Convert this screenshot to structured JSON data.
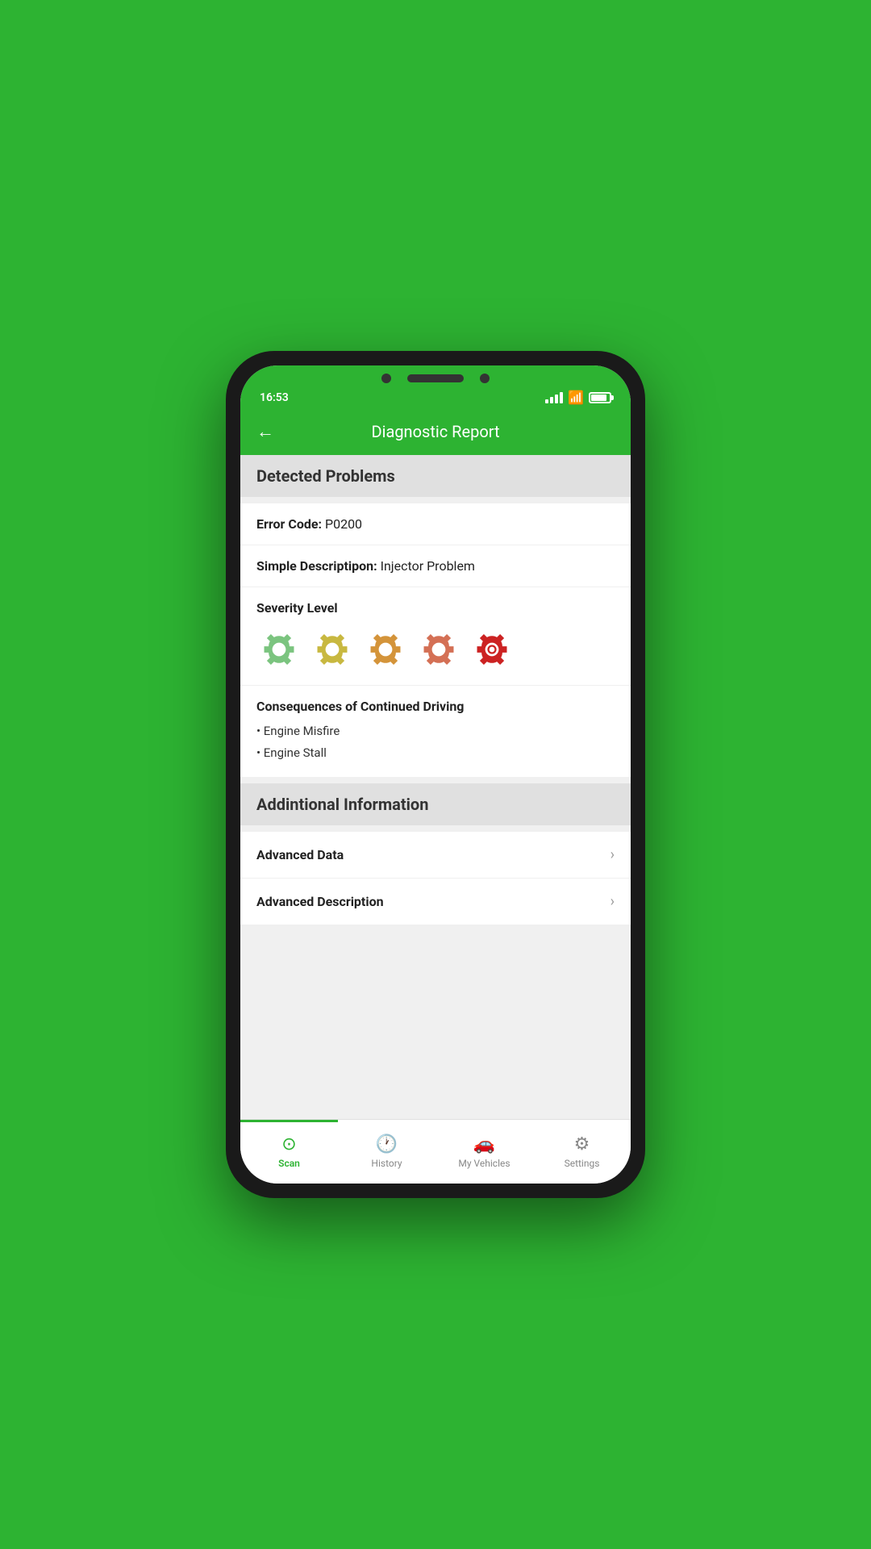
{
  "status_bar": {
    "time": "16:53"
  },
  "header": {
    "back_label": "←",
    "title": "Diagnostic Report"
  },
  "detected_problems": {
    "section_title": "Detected Problems",
    "error_code_label": "Error Code:",
    "error_code_value": "P0200",
    "simple_desc_label": "Simple Descriptipon:",
    "simple_desc_value": "Injector Problem",
    "severity_label": "Severity Level",
    "severity_levels": [
      {
        "color": "#7bc47f",
        "level": 1
      },
      {
        "color": "#d4b84a",
        "level": 2
      },
      {
        "color": "#d4a44a",
        "level": 3
      },
      {
        "color": "#d47a4a",
        "level": 4
      },
      {
        "color": "#cc2222",
        "level": 5
      }
    ],
    "consequences_title": "Consequences of Continued Driving",
    "consequences": [
      "Engine Misfire",
      "Engine Stall"
    ]
  },
  "additional_info": {
    "section_title": "Addintional Information",
    "items": [
      {
        "label": "Advanced Data",
        "id": "advanced-data"
      },
      {
        "label": "Advanced Description",
        "id": "advanced-description"
      }
    ]
  },
  "bottom_nav": {
    "items": [
      {
        "label": "Scan",
        "icon": "⊙",
        "active": true,
        "id": "scan"
      },
      {
        "label": "History",
        "icon": "🕐",
        "active": false,
        "id": "history"
      },
      {
        "label": "My Vehicles",
        "icon": "🚗",
        "active": false,
        "id": "my-vehicles"
      },
      {
        "label": "Settings",
        "icon": "⚙",
        "active": false,
        "id": "settings"
      }
    ]
  }
}
